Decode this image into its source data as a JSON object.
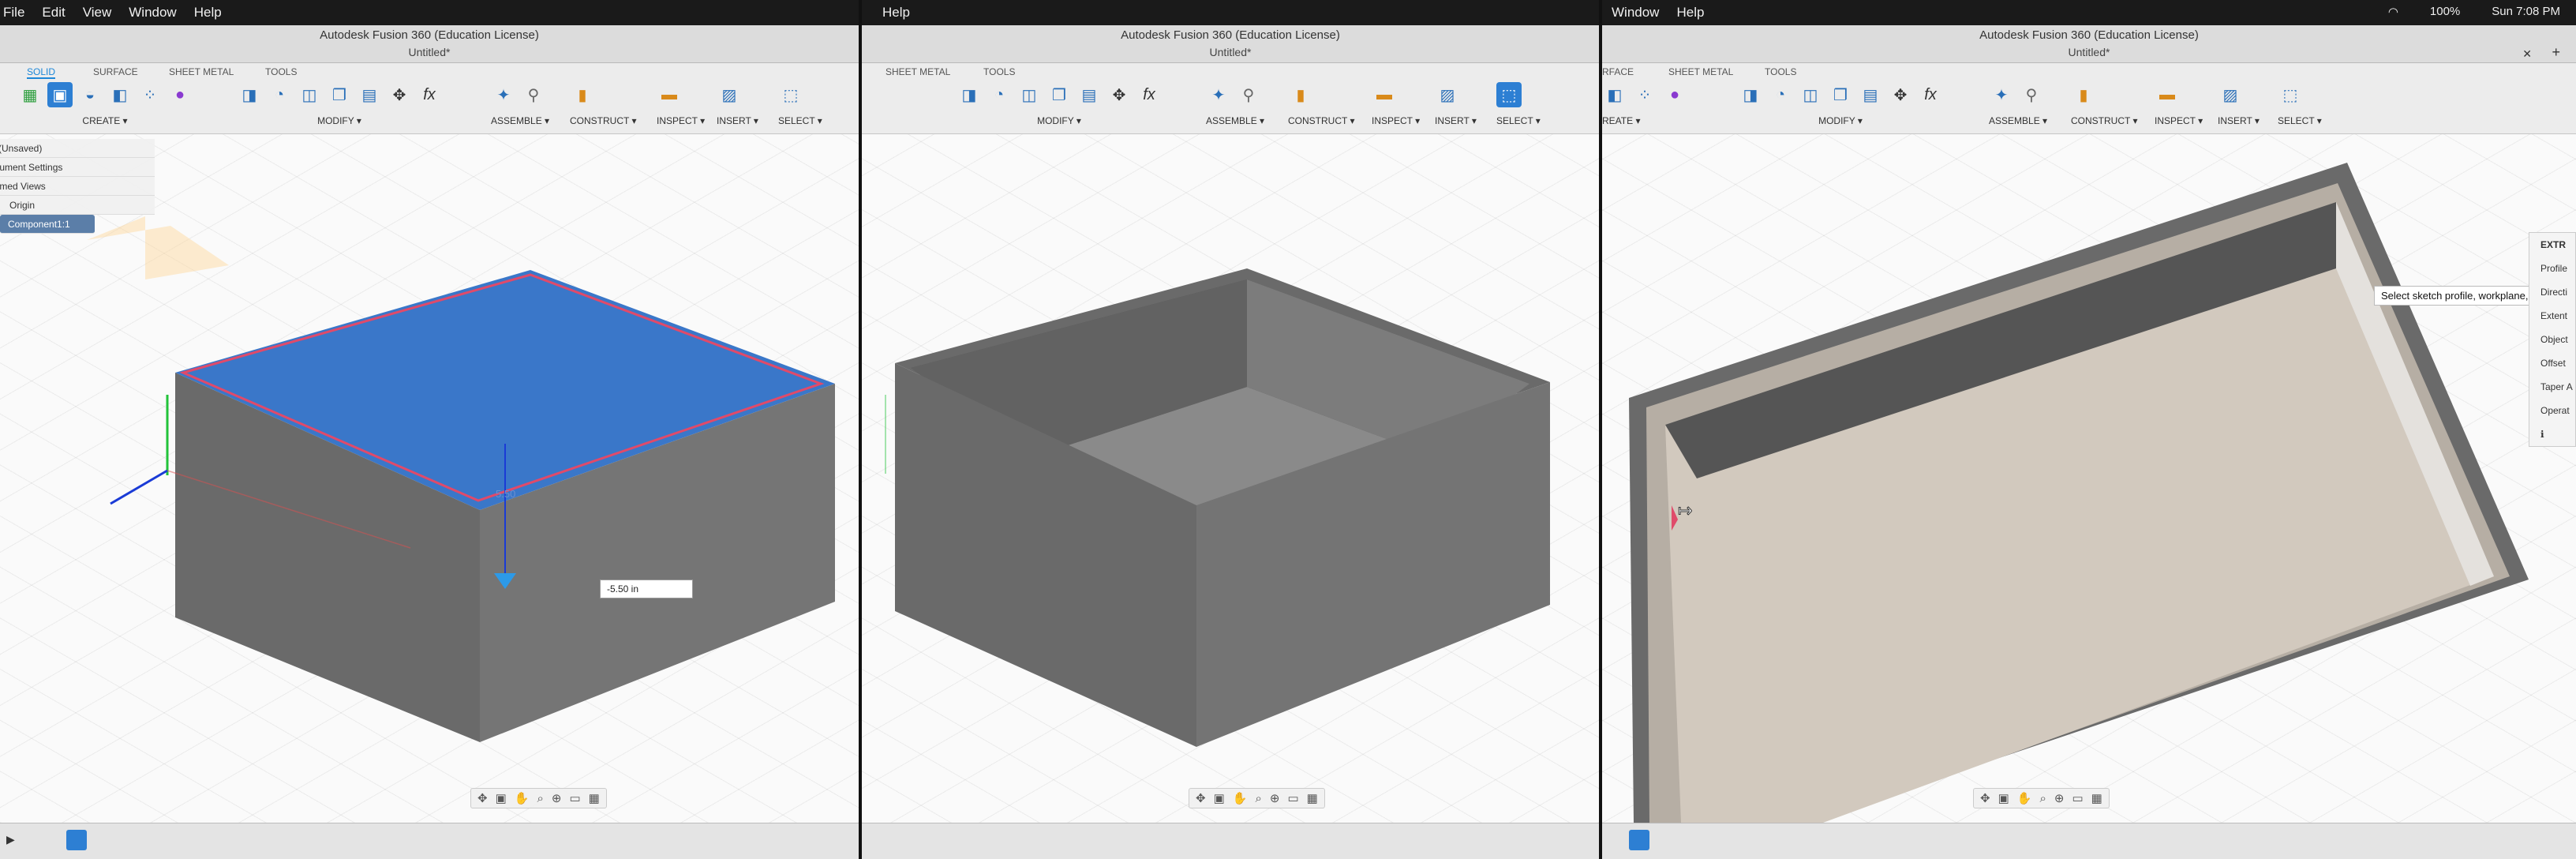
{
  "menus": {
    "left": [
      "File",
      "Edit",
      "View",
      "Window",
      "Help"
    ],
    "middle": [
      "Help"
    ],
    "right": [
      "Window",
      "Help"
    ]
  },
  "app_title": "Autodesk Fusion 360 (Education License)",
  "document_tab": "Untitled*",
  "toolbar": {
    "tabs_left": [
      "SOLID",
      "SURFACE",
      "SHEET METAL",
      "TOOLS"
    ],
    "tabs_middle": [
      "SHEET METAL",
      "TOOLS"
    ],
    "tabs_right": [
      "RFACE",
      "SHEET METAL",
      "TOOLS"
    ],
    "groups": {
      "create": "CREATE ▾",
      "modify": "MODIFY ▾",
      "assemble": "ASSEMBLE ▾",
      "construct": "CONSTRUCT ▾",
      "inspect": "INSPECT ▾",
      "insert": "INSERT ▾",
      "select": "SELECT ▾"
    },
    "right_create": "REATE ▾"
  },
  "browser": {
    "rows": [
      "(Unsaved)",
      "Document Settings",
      "Named Views",
      "Origin",
      "Component1:1"
    ]
  },
  "dimension_value": "-5.50 in",
  "dimension_label": "5.50",
  "tooltip": "Select sketch profile, workplane, vertex",
  "command_panel": {
    "title": "EXTR",
    "rows": [
      "Profile",
      "Directi",
      "Extent",
      "Object",
      "Offset",
      "Taper A",
      "Operat"
    ]
  },
  "status": {
    "battery": "100%",
    "clock": "Sun 7:08 PM"
  },
  "colors": {
    "selected_face": "#3a77c9",
    "body_dark": "#606060",
    "body_side": "#757575",
    "edge_highlight": "#e04a6a",
    "axis_green": "#22c33a",
    "axis_blue": "#1a3bd6",
    "axis_red": "#e05050"
  }
}
